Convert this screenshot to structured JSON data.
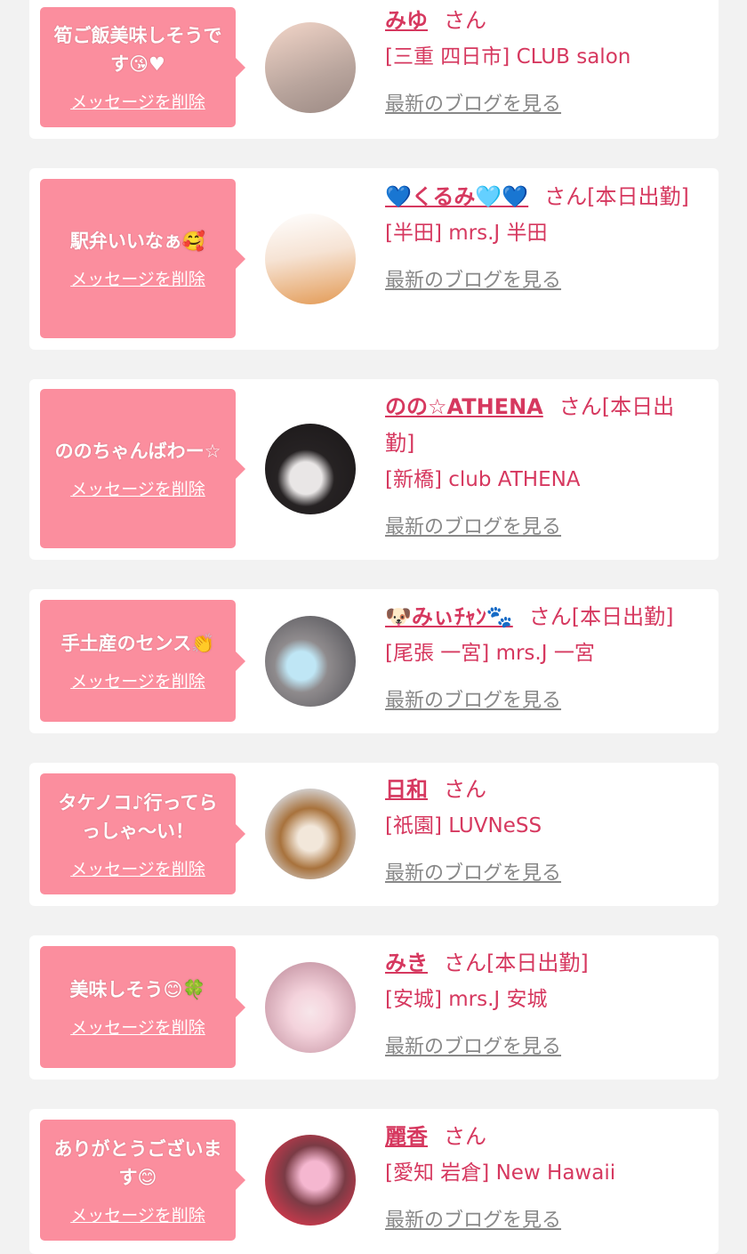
{
  "cards": [
    {
      "comment": "筍ご飯美味しそうです😘♥",
      "delete_label": "メッセージを削除",
      "name": "みゆ",
      "suffix": "さん",
      "shop": "[三重 四日市] CLUB salon",
      "blog_link": "最新のブログを見る",
      "avatar_colors": [
        "#f3d6c9",
        "#9c8a84"
      ]
    },
    {
      "comment": "駅弁いいなぁ🥰",
      "delete_label": "メッセージを削除",
      "name": "💙くるみ🩵💙",
      "suffix": "さん[本日出勤]",
      "shop": "[半田] mrs.J 半田",
      "blog_link": "最新のブログを見る",
      "avatar_colors": [
        "#f6e3d4",
        "#e39a54"
      ]
    },
    {
      "comment": "ののちゃんばわー☆",
      "delete_label": "メッセージを削除",
      "name": "のの☆ATHENA",
      "suffix": "さん[本日出勤]",
      "shop": "[新橋] club ATHENA",
      "blog_link": "最新のブログを見る",
      "avatar_colors": [
        "#262223",
        "#e9e6e6"
      ]
    },
    {
      "comment": "手土産のセンス👏",
      "delete_label": "メッセージを削除",
      "name": "🐶みぃﾁｬﾝ🐾",
      "suffix": "さん[本日出勤]",
      "shop": "[尾張 一宮] mrs.J 一宮",
      "blog_link": "最新のブログを見る",
      "avatar_colors": [
        "#4a4a50",
        "#bfe6f5"
      ]
    },
    {
      "comment": "タケノコ♪行ってらっしゃ〜い！",
      "delete_label": "メッセージを削除",
      "name": "日和",
      "suffix": "さん",
      "shop": "[祇園] LUVNeSS",
      "blog_link": "最新のブログを見る",
      "avatar_colors": [
        "#d9dde4",
        "#a8723c"
      ]
    },
    {
      "comment": "美味しそう😊🍀",
      "delete_label": "メッセージを削除",
      "name": "みき",
      "suffix": "さん[本日出勤]",
      "shop": "[安城] mrs.J 安城",
      "blog_link": "最新のブログを見る",
      "avatar_colors": [
        "#f4d3dc",
        "#c99aa8"
      ]
    },
    {
      "comment": "ありがとうございます😊",
      "delete_label": "メッセージを削除",
      "name": "麗香",
      "suffix": "さん",
      "shop": "[愛知 岩倉] New Hawaii",
      "blog_link": "最新のブログを見る",
      "avatar_colors": [
        "#c9394c",
        "#f5b7d0"
      ]
    }
  ]
}
